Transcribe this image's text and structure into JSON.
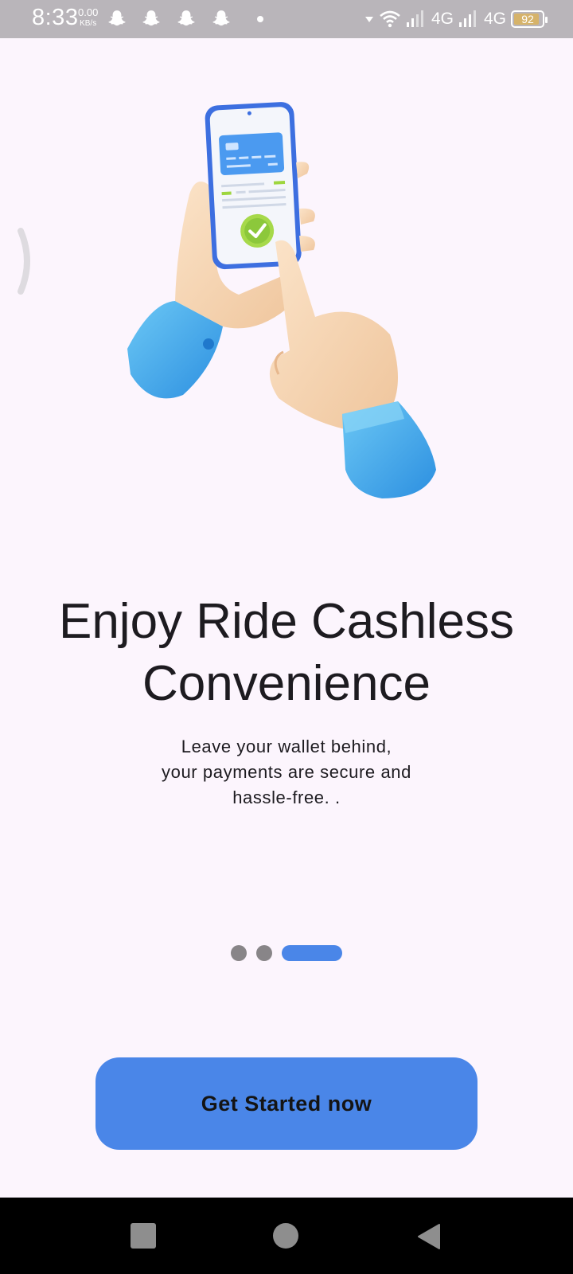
{
  "status_bar": {
    "time": "8:33",
    "net_speed_value": "0.00",
    "net_speed_unit": "KB/s",
    "network_1": "4G",
    "network_2": "4G",
    "battery": "92",
    "battery_level": 0.92
  },
  "onboarding": {
    "title": "Enjoy Ride Cashless Convenience",
    "subtitle": "Leave your wallet behind,\nyour payments are secure and\nhassle-free. .",
    "pager": {
      "total": 3,
      "active_index": 2
    },
    "cta_label": "Get Started now"
  },
  "colors": {
    "accent": "#4a86e8",
    "background": "#fcf5fd",
    "status_bar": "#b9b5ba",
    "inactive_dot": "#888588"
  },
  "icons": {
    "notifications": [
      "snapchat-icon",
      "snapchat-icon",
      "snapchat-icon",
      "snapchat-icon"
    ],
    "system": [
      "wifi-icon",
      "signal-icon",
      "signal-icon",
      "battery-icon"
    ],
    "nav": [
      "recent-apps-icon",
      "home-icon",
      "back-icon"
    ]
  }
}
